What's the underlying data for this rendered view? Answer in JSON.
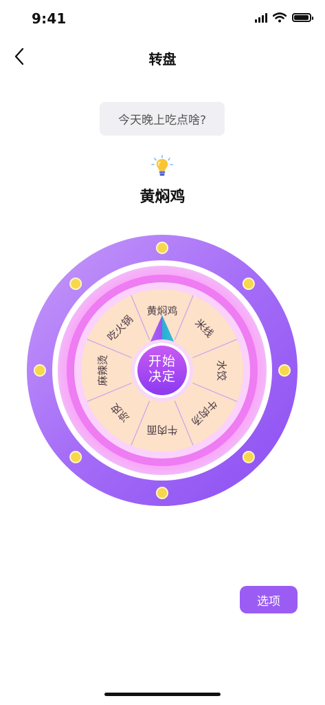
{
  "status_bar": {
    "time": "9:41"
  },
  "nav": {
    "title": "转盘"
  },
  "question": "今天晚上吃点啥?",
  "result": "黄焖鸡",
  "wheel": {
    "segments": [
      "黄焖鸡",
      "米线",
      "水饺",
      "牛肉汤",
      "牛肉面",
      "凉皮",
      "麻辣烫",
      "吃火锅"
    ],
    "start_label_line1": "开始",
    "start_label_line2": "决定"
  },
  "options_label": "选项",
  "colors": {
    "accent": "#9b5cf4",
    "ring_outer": "#a46cf7",
    "ring_pink": "#f07cf2",
    "segment_fill": "#fde1c9",
    "dots": "#f7d84c"
  }
}
